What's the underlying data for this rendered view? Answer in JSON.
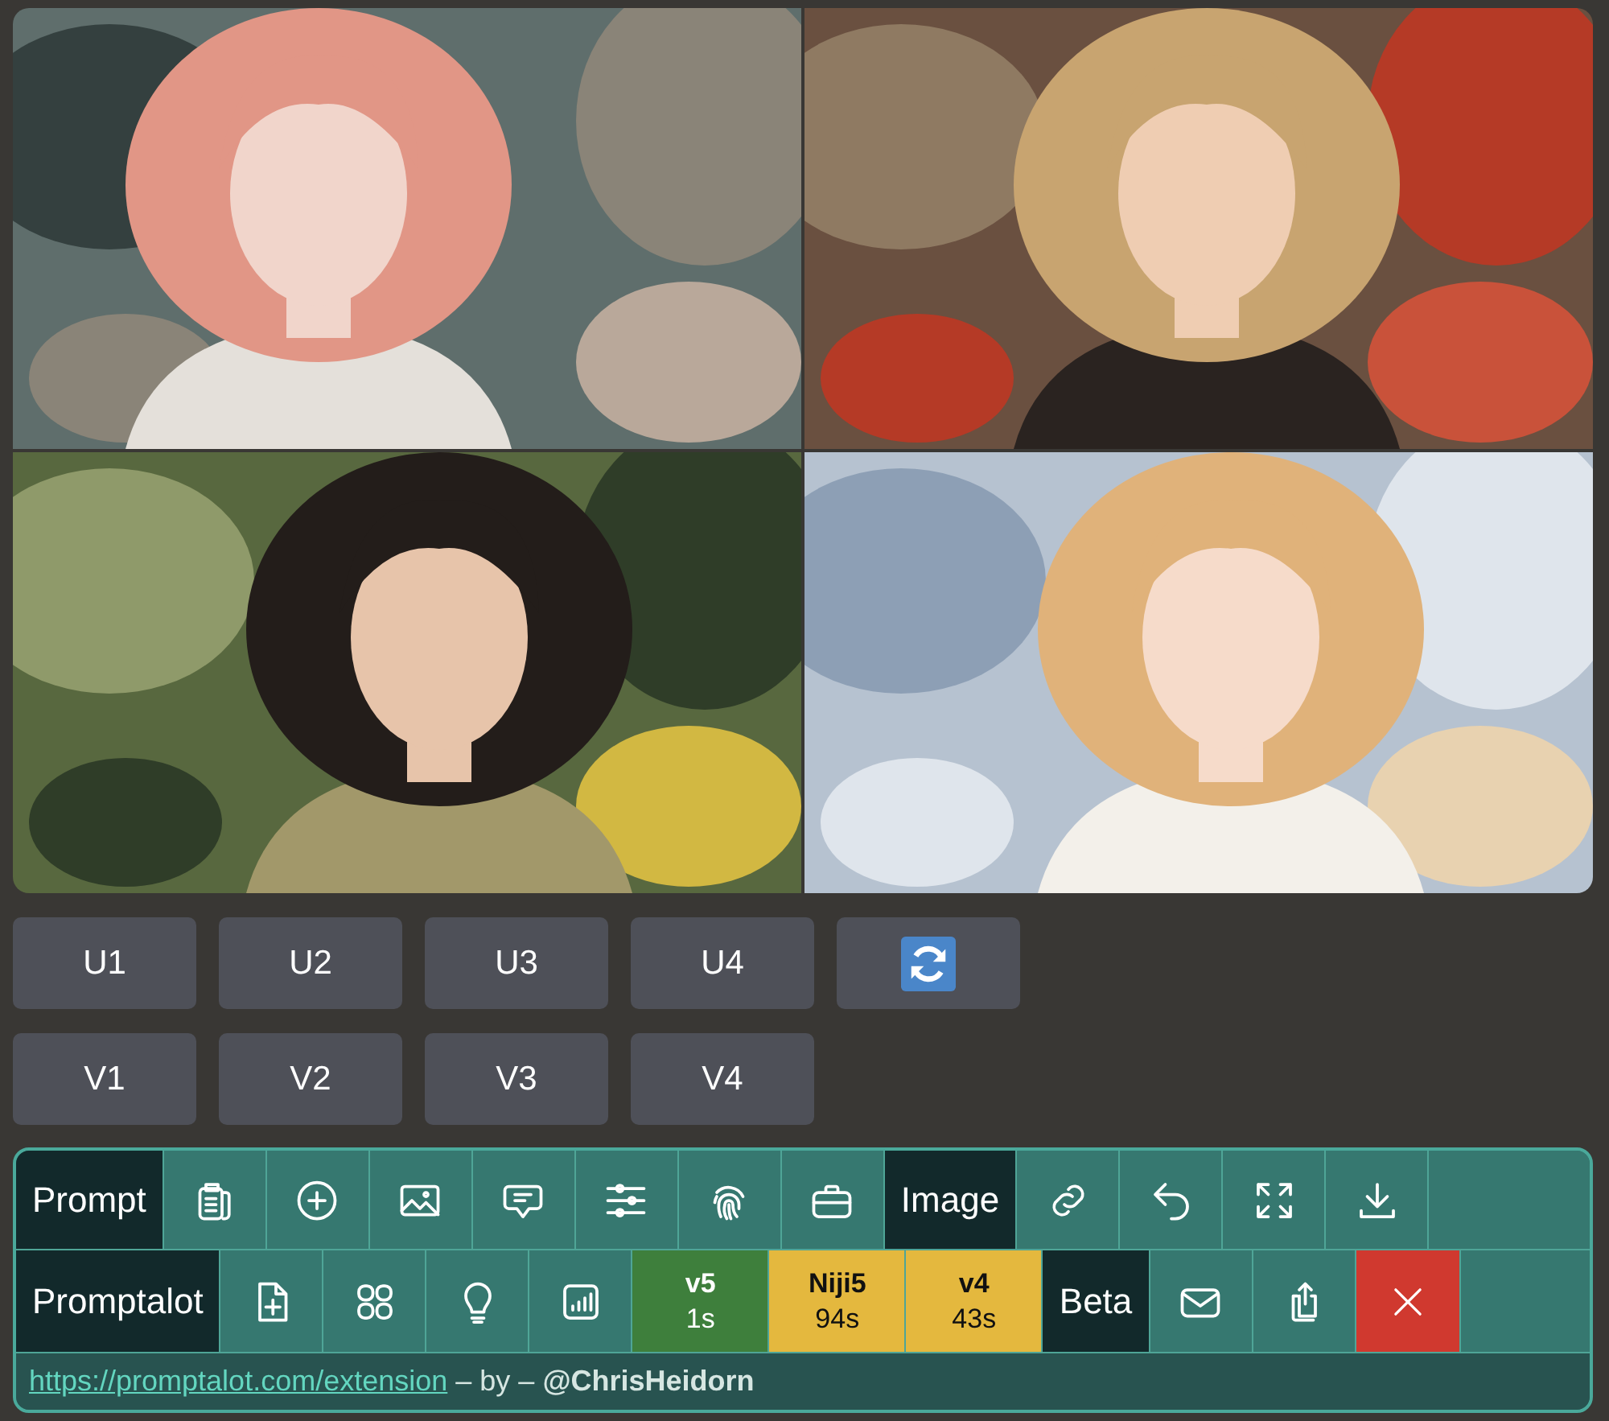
{
  "upscale_buttons": [
    "U1",
    "U2",
    "U3",
    "U4"
  ],
  "variation_buttons": [
    "V1",
    "V2",
    "V3",
    "V4"
  ],
  "toolbar": {
    "rows": [
      {
        "items": [
          {
            "kind": "label",
            "text": "Prompt"
          },
          {
            "kind": "icon"
          },
          {
            "kind": "icon"
          },
          {
            "kind": "icon"
          },
          {
            "kind": "icon"
          },
          {
            "kind": "icon"
          },
          {
            "kind": "icon"
          },
          {
            "kind": "icon"
          },
          {
            "kind": "label",
            "text": "Image"
          },
          {
            "kind": "icon"
          },
          {
            "kind": "icon"
          },
          {
            "kind": "icon"
          },
          {
            "kind": "icon"
          },
          {
            "kind": "spacer"
          }
        ]
      },
      {
        "items": [
          {
            "kind": "label",
            "text": "Promptalot"
          },
          {
            "kind": "icon"
          },
          {
            "kind": "icon"
          },
          {
            "kind": "icon"
          },
          {
            "kind": "icon"
          },
          {
            "kind": "model",
            "title": "v5",
            "time": "1s",
            "color": "#3e7f3c"
          },
          {
            "kind": "model",
            "title": "Niji5",
            "time": "94s",
            "color": "#e4b83e"
          },
          {
            "kind": "model",
            "title": "v4",
            "time": "43s",
            "color": "#e4b83e"
          },
          {
            "kind": "label",
            "text": "Beta"
          },
          {
            "kind": "icon"
          },
          {
            "kind": "icon"
          },
          {
            "kind": "close"
          },
          {
            "kind": "spacer"
          }
        ]
      }
    ],
    "footer": {
      "link": "https://promptalot.com/extension",
      "text": " – by – **@ChrisHeidorn**"
    }
  }
}
